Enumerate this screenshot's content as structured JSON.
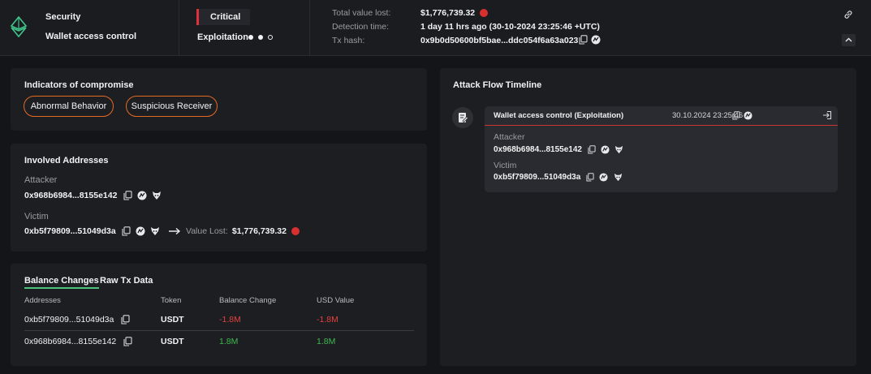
{
  "header": {
    "category": "Security",
    "attack_type": "Wallet access control",
    "severity": "Critical",
    "stage": "Exploitation",
    "stage_progress": 2,
    "stage_total": 3,
    "total_value_lost_label": "Total value lost:",
    "total_value_lost": "$1,776,739.32",
    "detection_time_label": "Detection time:",
    "detection_time": "1 day 11 hrs ago (30-10-2024 23:25:46 +UTC)",
    "tx_hash_label": "Tx hash:",
    "tx_hash": "0x9b0d50600bf5bae...ddc054f6a63a023",
    "colors": {
      "accent_green": "#4cc27a",
      "critical_red": "#e0313a",
      "pill_orange": "#e46a24"
    }
  },
  "indicators": {
    "title": "Indicators of compromise",
    "items": [
      "Abnormal Behavior",
      "Suspicious Receiver"
    ]
  },
  "involved": {
    "title": "Involved Addresses",
    "attacker_label": "Attacker",
    "attacker_address": "0x968b6984...8155e142",
    "victim_label": "Victim",
    "victim_address": "0xb5f79809...51049d3a",
    "value_lost_label": "Value Lost:",
    "value_lost": "$1,776,739.32"
  },
  "balance": {
    "tabs": [
      "Balance Changes",
      "Raw Tx Data"
    ],
    "columns": [
      "Addresses",
      "Token",
      "Balance Change",
      "USD Value"
    ],
    "rows": [
      {
        "address": "0xb5f79809...51049d3a",
        "token": "USDT",
        "change": "-1.8M",
        "usd": "-1.8M"
      },
      {
        "address": "0x968b6984...8155e142",
        "token": "USDT",
        "change": "1.8M",
        "usd": "1.8M"
      }
    ]
  },
  "timeline": {
    "title": "Attack Flow Timeline",
    "event_title": "Wallet access control",
    "event_stage": "(Exploitation)",
    "event_time": "30.10.2024 23:25:46",
    "attacker_label": "Attacker",
    "attacker_address": "0x968b6984...8155e142",
    "victim_label": "Victim",
    "victim_address": "0xb5f79809...51049d3a"
  }
}
